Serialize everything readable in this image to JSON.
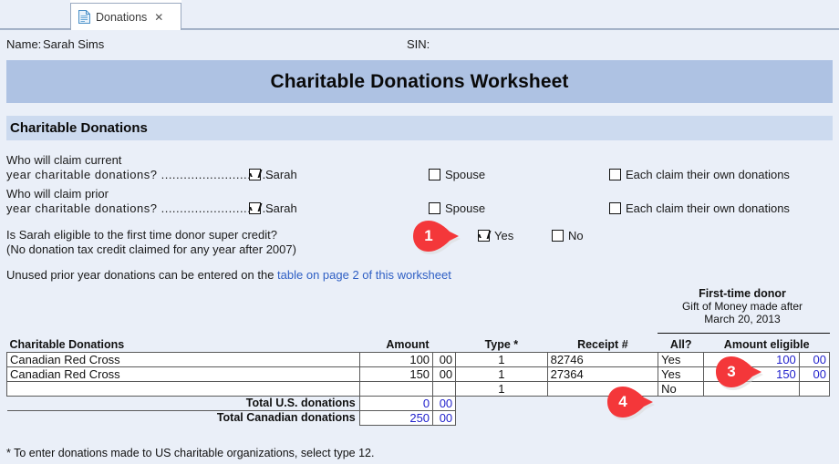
{
  "tab": {
    "label": "Donations",
    "close_label": "✕",
    "icon": "document-icon"
  },
  "header": {
    "name_label": "Name:",
    "name_value": "Sarah Sims",
    "sin_label": "SIN:"
  },
  "title_band": {
    "text": "Charitable Donations Worksheet",
    "color": "#aec2e3"
  },
  "section": {
    "title": "Charitable Donations",
    "color": "#ccdaef"
  },
  "questions": {
    "current_year": {
      "line1": "Who will claim current",
      "line2": "year charitable donations? ..............................",
      "options": [
        {
          "label": "Sarah",
          "checked": true
        },
        {
          "label": "Spouse",
          "checked": false
        },
        {
          "label": "Each claim their own donations",
          "checked": false
        }
      ]
    },
    "prior_year": {
      "line1": "Who will claim prior",
      "line2": "year charitable donations? ..............................",
      "options": [
        {
          "label": "Sarah",
          "checked": true
        },
        {
          "label": "Spouse",
          "checked": false
        },
        {
          "label": "Each claim their own donations",
          "checked": false
        }
      ]
    },
    "super_credit": {
      "line1": "Is Sarah eligible to the first time donor super credit?",
      "line2": "(No donation tax credit claimed for any year after 2007)",
      "options": [
        {
          "label": "Yes",
          "checked": true
        },
        {
          "label": "No",
          "checked": false
        }
      ]
    }
  },
  "unused_note": {
    "text": "Unused prior year donations can be entered on the ",
    "link_text": "table on page 2 of this worksheet"
  },
  "first_time_donor_header": {
    "line1": "First-time donor",
    "line2": "Gift of Money made after",
    "line3": "March 20, 2013"
  },
  "table": {
    "columns": [
      "Charitable Donations",
      "Amount",
      "Type *",
      "Receipt #",
      "All?",
      "Amount eligible"
    ],
    "rows": [
      {
        "donation": "Canadian Red Cross",
        "amount": "100",
        "amount_cents": "00",
        "type": "1",
        "receipt": "82746",
        "all": "Yes",
        "eligible": "100",
        "eligible_cents": "00"
      },
      {
        "donation": "Canadian Red Cross",
        "amount": "150",
        "amount_cents": "00",
        "type": "1",
        "receipt": "27364",
        "all": "Yes",
        "eligible": "150",
        "eligible_cents": "00"
      },
      {
        "donation": "",
        "amount": "",
        "amount_cents": "",
        "type": "1",
        "receipt": "",
        "all": "No",
        "eligible": "",
        "eligible_cents": ""
      }
    ],
    "totals": [
      {
        "label": "Total U.S. donations",
        "value": "0",
        "cents": "00"
      },
      {
        "label": "Total Canadian donations",
        "value": "250",
        "cents": "00"
      }
    ]
  },
  "footnote": "* To enter donations made to US charitable organizations, select type 12.",
  "markers": [
    {
      "number": "1"
    },
    {
      "number": "3"
    },
    {
      "number": "4"
    }
  ],
  "colors": {
    "marker_red": "#f4373a",
    "value_blue": "#2222cc",
    "link_blue": "#2f5fc4",
    "page_bg": "#eaeff8"
  }
}
